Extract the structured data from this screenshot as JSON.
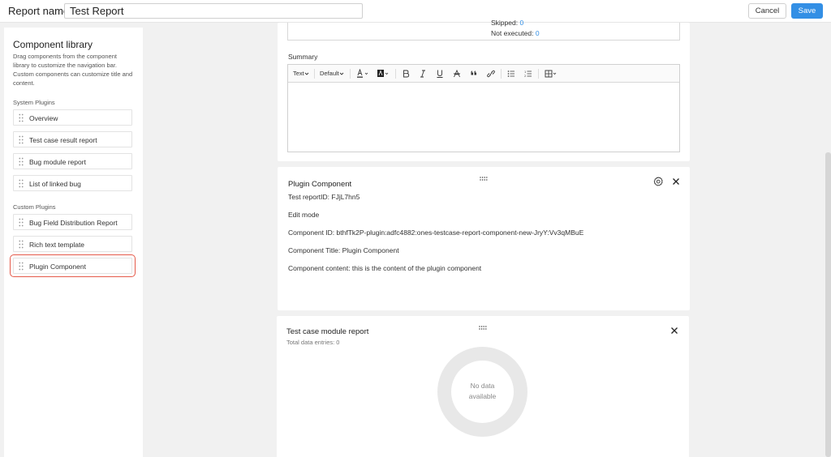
{
  "header": {
    "report_name_label": "Report name:",
    "report_name_value": "Test Report",
    "cancel_label": "Cancel",
    "save_label": "Save"
  },
  "sidebar": {
    "title": "Component library",
    "description": "Drag components from the component library to customize the navigation bar. Custom components can customize title and content.",
    "system_section": "System Plugins",
    "system_plugins": [
      "Overview",
      "Test case result report",
      "Bug module report",
      "List of linked bug"
    ],
    "custom_section": "Custom Plugins",
    "custom_plugins": [
      "Bug Field Distribution Report",
      "Rich text template",
      "Plugin Component"
    ]
  },
  "result_summary": {
    "skipped_label": "Skipped:",
    "skipped_value": "0",
    "not_executed_label": "Not executed:",
    "not_executed_value": "0"
  },
  "summary": {
    "label": "Summary",
    "toolbar": {
      "text_style": "Text",
      "font": "Default"
    }
  },
  "plugin_card": {
    "title": "Plugin Component",
    "report_id": "Test reportID: FJjL7hn5",
    "mode": "Edit mode",
    "component_id": "Component ID: bthfTk2P-plugin:adfc4882:ones-testcase-report-component-new-JryY:Vv3qMBuE",
    "component_title": "Component Title: Plugin Component",
    "component_content": "Component content: this is the content of the plugin component"
  },
  "module_card": {
    "title": "Test case module report",
    "entries": "Total data entries: 0",
    "empty_line1": "No data",
    "empty_line2": "available"
  },
  "colors": {
    "accent": "#338fe5",
    "selected_outline": "#e55a4a"
  }
}
